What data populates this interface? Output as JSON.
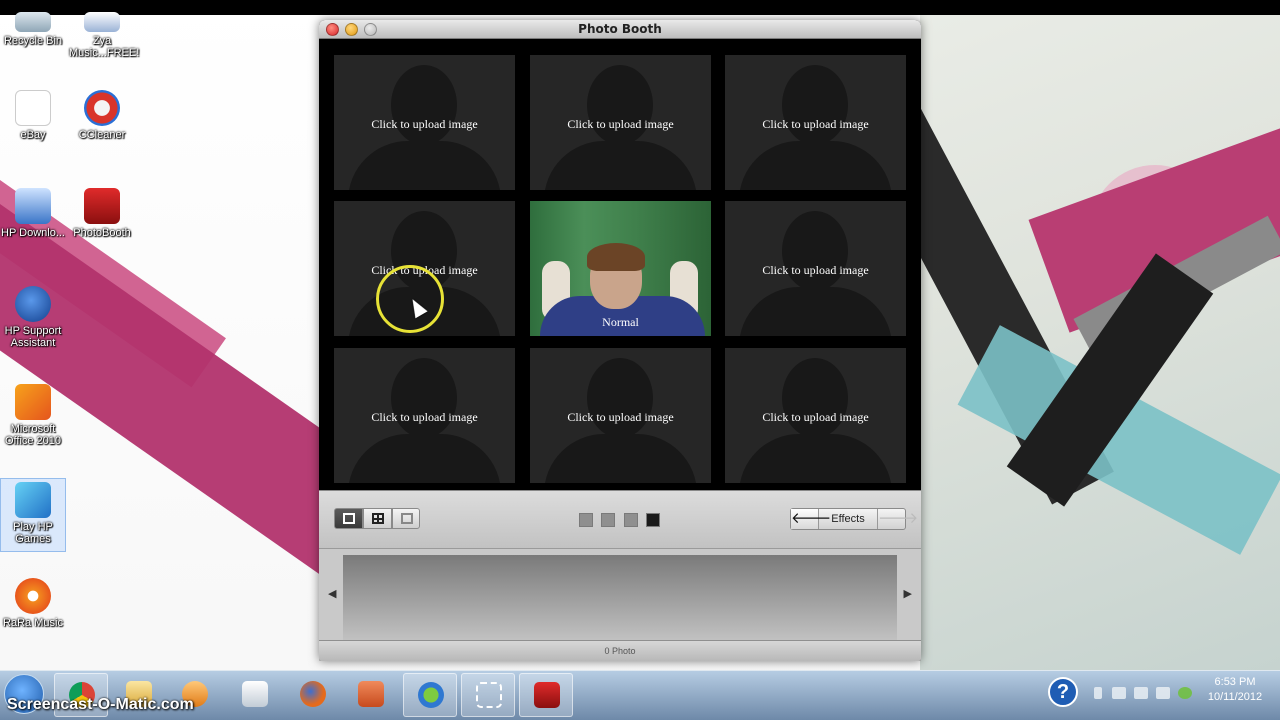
{
  "desktop": {
    "icons": [
      {
        "label": "Recycle Bin",
        "icon": "recycle-bin-icon"
      },
      {
        "label": "Zya Music...FREE!",
        "icon": "music-icon"
      },
      {
        "label": "eBay",
        "icon": "ebay-icon"
      },
      {
        "label": "CCleaner",
        "icon": "ccleaner-icon"
      },
      {
        "label": "HP Downlo...",
        "icon": "hp-download-icon"
      },
      {
        "label": "PhotoBooth",
        "icon": "photobooth-icon"
      },
      {
        "label": "HP Support Assistant",
        "icon": "help-icon"
      },
      {
        "label": "Microsoft Office 2010",
        "icon": "office-icon"
      },
      {
        "label": "Play HP Games",
        "icon": "games-icon"
      },
      {
        "label": "RaRa Music",
        "icon": "rara-icon"
      }
    ]
  },
  "window": {
    "title": "Photo Booth",
    "tiles": [
      {
        "label": "Click to upload image"
      },
      {
        "label": "Click to upload image"
      },
      {
        "label": "Click to upload image"
      },
      {
        "label": "Click to upload image"
      },
      {
        "label": "Normal"
      },
      {
        "label": "Click to upload image"
      },
      {
        "label": "Click to upload image"
      },
      {
        "label": "Click to upload image"
      },
      {
        "label": "Click to upload image"
      }
    ],
    "toolbar": {
      "effects_label": "Effects",
      "back_arrow": "🡐",
      "forward_arrow": "🡒",
      "pages": 4,
      "active_page": 4
    },
    "tray": {
      "left_arrow": "◀",
      "right_arrow": "▶"
    },
    "status": "0 Photo"
  },
  "taskbar": {
    "help_glyph": "?",
    "time": "6:53 PM",
    "date": "10/11/2012"
  },
  "watermark": "Screencast-O-Matic.com"
}
